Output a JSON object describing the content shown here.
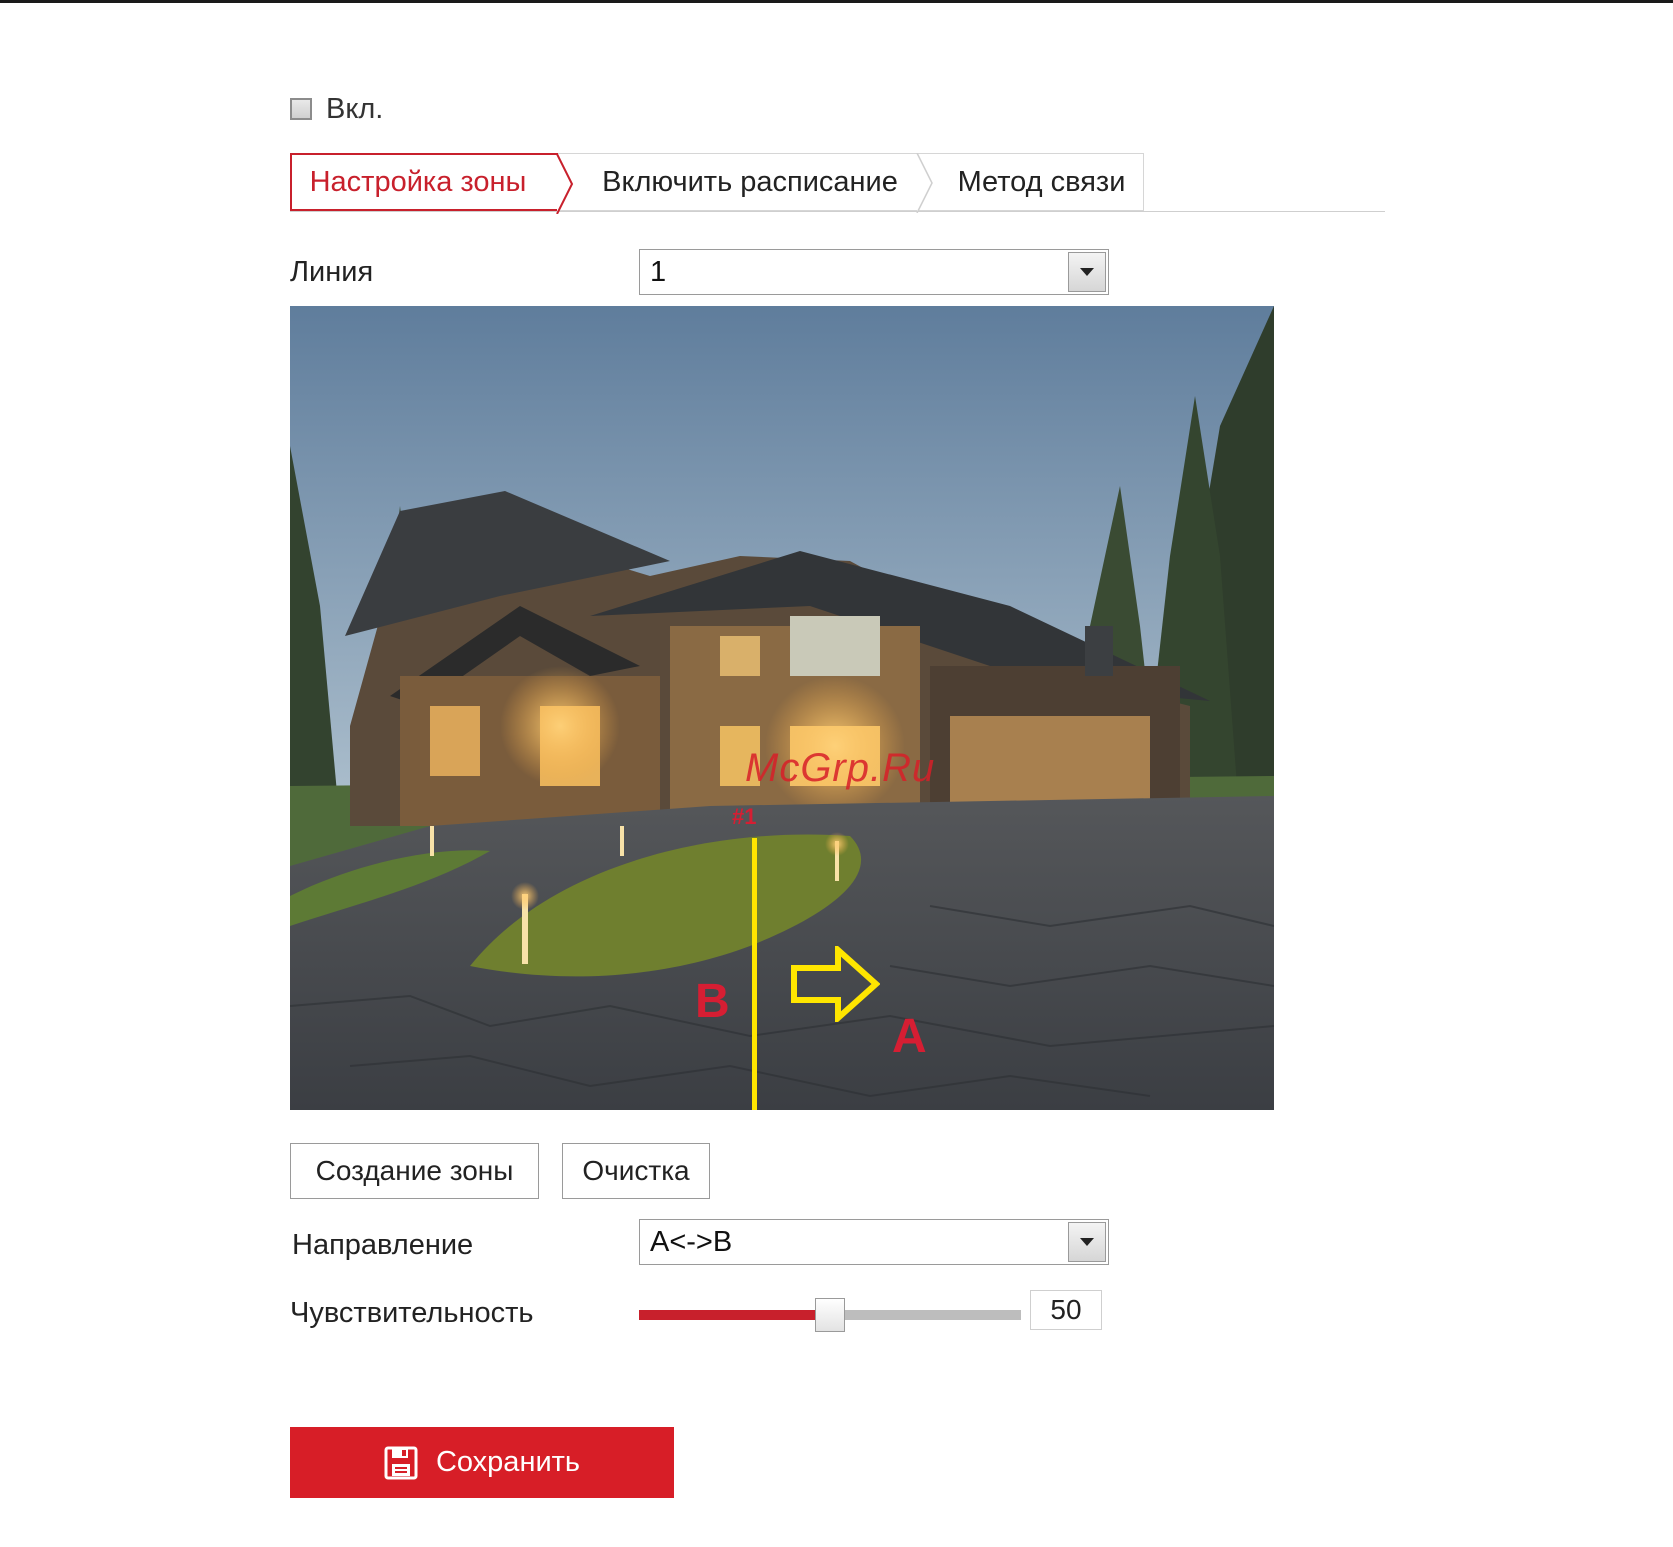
{
  "enable": {
    "label": "Вкл.",
    "checked": false
  },
  "tabs": [
    {
      "label": "Настройка зоны",
      "active": true
    },
    {
      "label": "Включить расписание",
      "active": false
    },
    {
      "label": "Метод связи",
      "active": false
    }
  ],
  "line": {
    "label": "Линия",
    "value": "1"
  },
  "video": {
    "side_b": "B",
    "side_a": "A",
    "rule_id": "#1",
    "watermark": "McGrp.Ru"
  },
  "buttons": {
    "create_zone": "Создание зоны",
    "clear": "Очистка"
  },
  "direction": {
    "label": "Направление",
    "value": "A<->B"
  },
  "sensitivity": {
    "label": "Чувствительность",
    "value": "50",
    "percent": 50
  },
  "save": {
    "label": "Сохранить"
  },
  "colors": {
    "accent": "#d71e27",
    "rule_line": "#ffe600"
  }
}
